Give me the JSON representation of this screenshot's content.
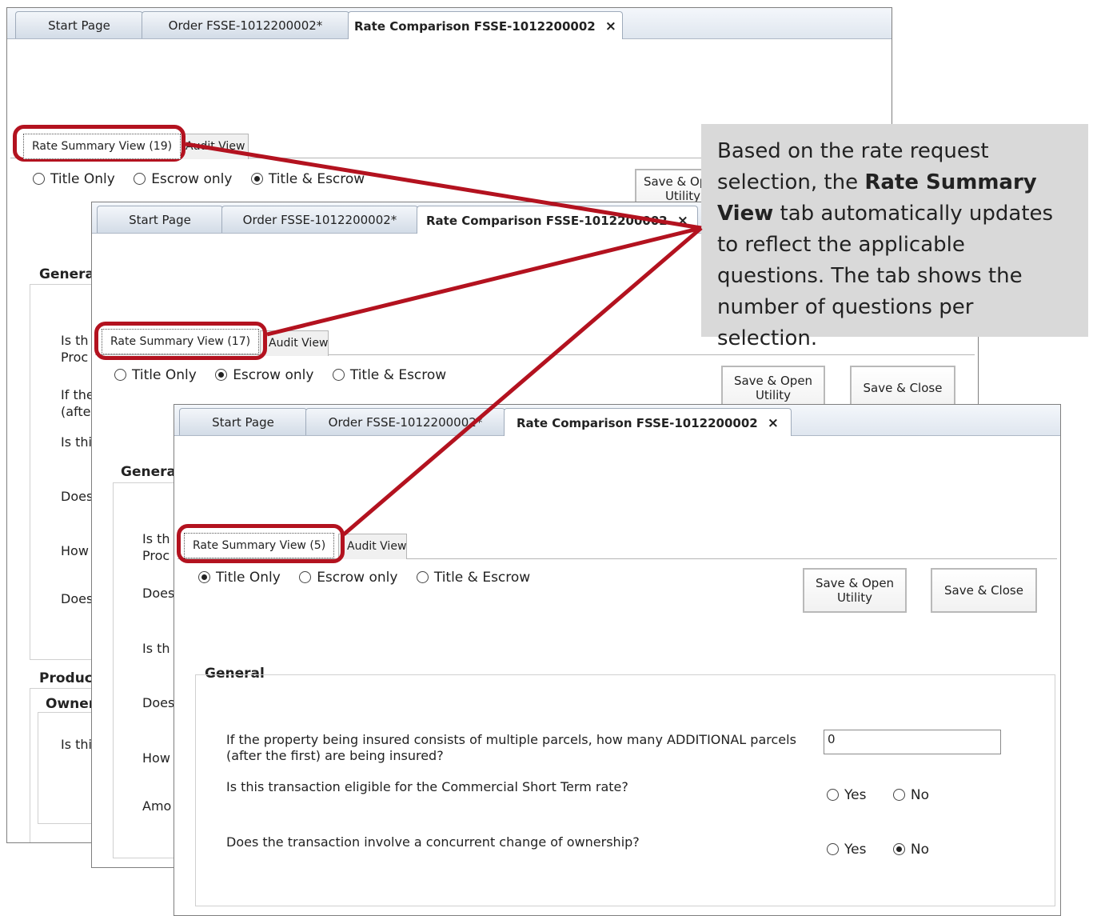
{
  "tabs": {
    "start_page": "Start Page",
    "order": "Order FSSE-1012200002*",
    "rate_comparison": "Rate Comparison FSSE-1012200002",
    "close_symbol": "×"
  },
  "window1": {
    "summary_tab": "Rate Summary View (19)",
    "audit_tab": "Audit View",
    "radio_title_only": "Title Only",
    "radio_escrow_only": "Escrow only",
    "radio_title_escrow": "Title & Escrow",
    "save_open_btn": "Save & Open Utility",
    "section_general": "General",
    "section_product": "Product",
    "section_owner": "Owner",
    "q_fragments": [
      "Is th",
      "Proc",
      "If the",
      "(afte",
      "Is thi",
      "Does",
      "How",
      "Does",
      "Is thi"
    ]
  },
  "window2": {
    "summary_tab": "Rate Summary View (17)",
    "audit_tab": "Audit View",
    "radio_title_only": "Title Only",
    "radio_escrow_only": "Escrow only",
    "radio_title_escrow": "Title & Escrow",
    "save_open_btn": "Save & Open Utility",
    "save_close_btn": "Save & Close",
    "section_general": "General",
    "q_fragments": [
      "Is th",
      "Proc",
      "Does",
      "Is th",
      "Does",
      "How",
      "Amo"
    ]
  },
  "window3": {
    "summary_tab": "Rate Summary View (5)",
    "audit_tab": "Audit View",
    "radio_title_only": "Title Only",
    "radio_escrow_only": "Escrow only",
    "radio_title_escrow": "Title & Escrow",
    "save_open_btn": "Save & Open Utility",
    "save_close_btn": "Save & Close",
    "section_general": "General",
    "q1_line1": "If the property being insured consists of multiple parcels, how many ADDITIONAL parcels",
    "q1_line2": "(after the first) are being insured?",
    "q1_value": "0",
    "q2": "Is this transaction eligible for the Commercial Short Term rate?",
    "q3": "Does the transaction involve a concurrent change of ownership?",
    "yes": "Yes",
    "no": "No"
  },
  "callout": {
    "text_before": "Based on the rate request selection, the ",
    "bold": "Rate Summary View",
    "text_after": " tab automatically updates to reflect the applicable questions. The tab shows the number of questions per selection."
  },
  "colors": {
    "highlight": "#b3121f",
    "callout_bg": "#d9d9d9"
  }
}
